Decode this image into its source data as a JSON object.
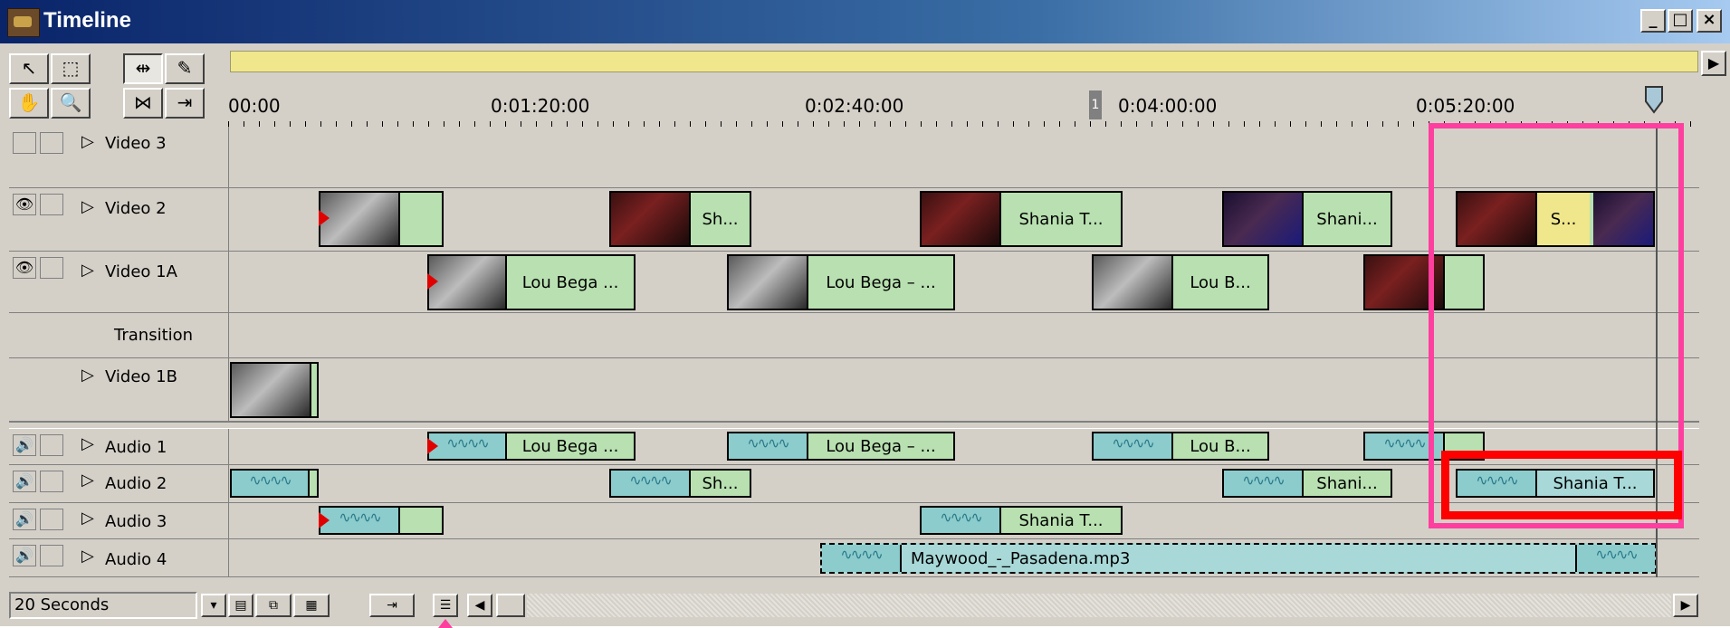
{
  "window": {
    "title": "Timeline",
    "controls": {
      "minimize": "_",
      "maximize": "□",
      "close": "×"
    }
  },
  "tools": [
    {
      "icon": "arrow-icon",
      "glyph": "↖"
    },
    {
      "icon": "range-select-icon",
      "glyph": "⬚"
    },
    {
      "icon": "ripple-edit-icon",
      "glyph": "⇹"
    },
    {
      "icon": "razor-icon",
      "glyph": "✎"
    },
    {
      "icon": "hand-icon",
      "glyph": "✋"
    },
    {
      "icon": "zoom-icon",
      "glyph": "🔍"
    },
    {
      "icon": "crossfade-icon",
      "glyph": "⋈"
    },
    {
      "icon": "in-out-icon",
      "glyph": "⇥"
    }
  ],
  "ruler": {
    "labels": [
      "00:00",
      "0:01:20:00",
      "0:02:40:00",
      "0:04:00:00",
      "0:05:20:00"
    ],
    "marker": "1"
  },
  "tracks": {
    "video3": {
      "name": "Video 3"
    },
    "video2": {
      "name": "Video 2"
    },
    "video1a": {
      "name": "Video 1A"
    },
    "transition": {
      "name": "Transition"
    },
    "video1b": {
      "name": "Video 1B"
    },
    "audio1": {
      "name": "Audio 1"
    },
    "audio2": {
      "name": "Audio 2"
    },
    "audio3": {
      "name": "Audio 3"
    },
    "audio4": {
      "name": "Audio 4"
    }
  },
  "clips": {
    "v2_1": "Sh...",
    "v2_2": "Shania T...",
    "v2_3": "Shani...",
    "v2_4": "S...",
    "v1a_1": "Lou Bega ...",
    "v1a_2": "Lou Bega – ...",
    "v1a_3": "Lou B...",
    "a1_1": "Lou Bega ...",
    "a1_2": "Lou Bega – ...",
    "a1_3": "Lou B...",
    "a2_1": "Sh...",
    "a2_2": "Shani...",
    "a2_3": "Shania T...",
    "a3_1": "Shania T...",
    "a4_1": "Maywood_-_Pasadena.mp3"
  },
  "bottom": {
    "zoom": "20 Seconds",
    "dropdown": "▾"
  },
  "colors": {
    "highlight_pink": "#ff3f9f",
    "highlight_red": "#ff0000",
    "video_clip": "#b8e0b0",
    "audio_clip": "#a8d8d8",
    "work_area": "#f0e68c"
  }
}
